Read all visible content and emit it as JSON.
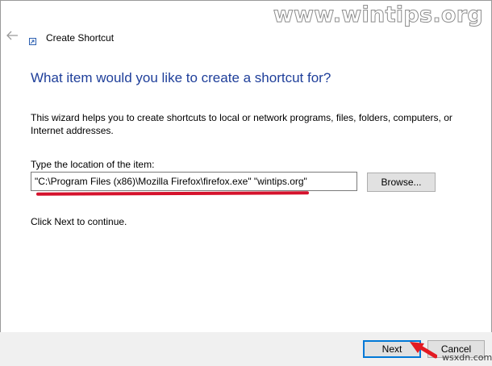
{
  "watermark": "www.wintips.org",
  "window": {
    "title": "Create Shortcut",
    "back_icon": "back-arrow-icon",
    "app_icon": "shortcut-icon"
  },
  "main": {
    "heading": "What item would you like to create a shortcut for?",
    "description": "This wizard helps you to create shortcuts to local or network programs, files, folders, computers, or Internet addresses.",
    "location_label": "Type the location of the item:",
    "location_value": "\"C:\\Program Files (x86)\\Mozilla Firefox\\firefox.exe\" \"wintips.org\"",
    "browse_label": "Browse...",
    "continue_text": "Click Next to continue."
  },
  "footer": {
    "next_label": "Next",
    "cancel_label": "Cancel"
  },
  "corner_watermark": "wsxdn.com",
  "colors": {
    "heading": "#1f3f9a",
    "underline": "#d5122c",
    "focus": "#0078d7",
    "arrow": "#e31b23"
  }
}
